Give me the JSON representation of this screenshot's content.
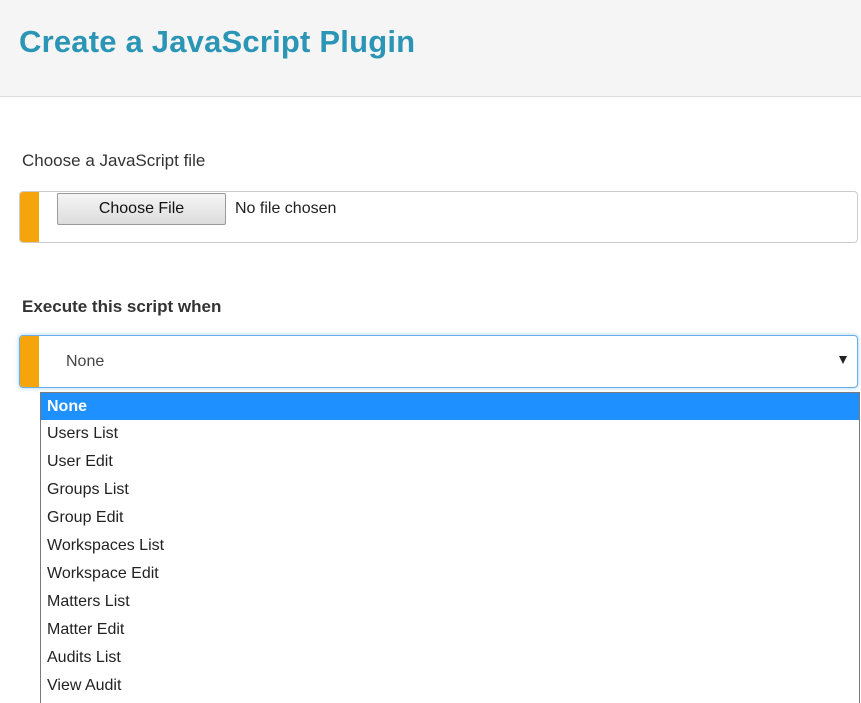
{
  "header": {
    "title": "Create a JavaScript Plugin"
  },
  "file_section": {
    "label": "Choose a JavaScript file",
    "button_label": "Choose File",
    "status": "No file chosen"
  },
  "trigger_section": {
    "label": "Execute this script when",
    "selected_value": "None",
    "options": [
      "None",
      "Users List",
      "User Edit",
      "Groups List",
      "Group Edit",
      "Workspaces List",
      "Workspace Edit",
      "Matters List",
      "Matter Edit",
      "Audits List",
      "View Audit"
    ],
    "selected_index": 0
  },
  "colors": {
    "title": "#2b95b5",
    "accent": "#f5a40c",
    "highlight": "#1e90ff"
  }
}
